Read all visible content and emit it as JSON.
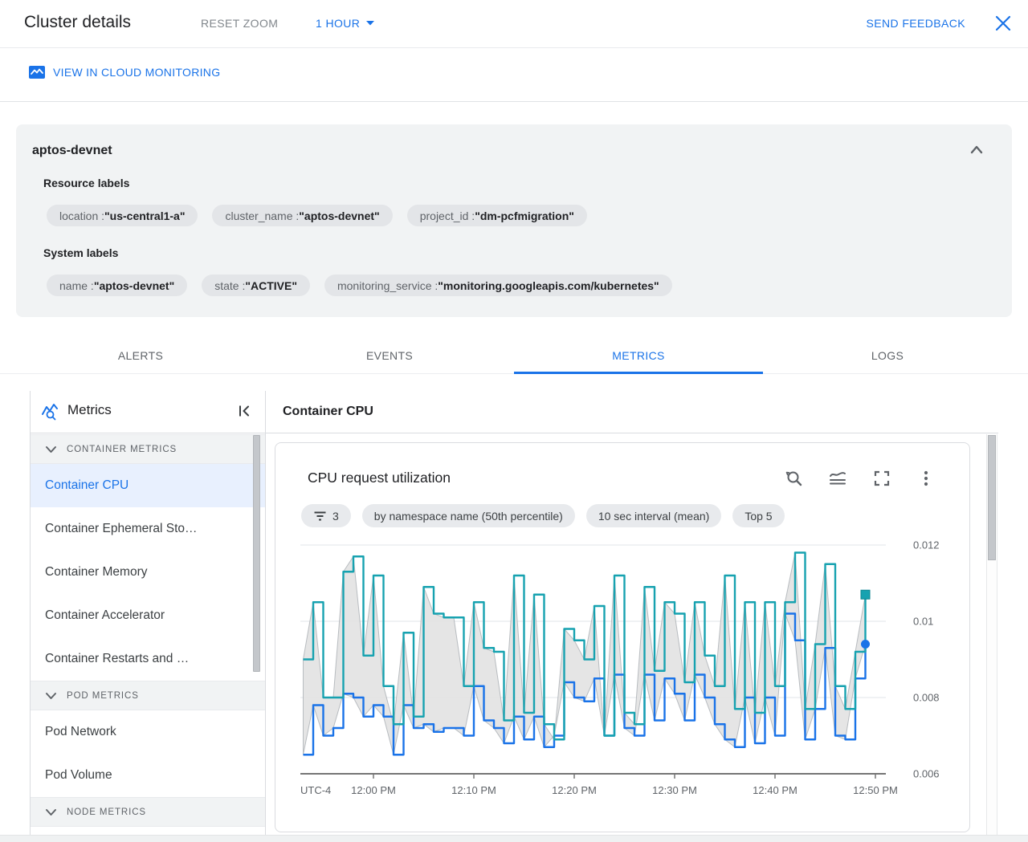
{
  "colors": {
    "accent": "#1a73e8",
    "series_teal": "#17a2b0",
    "series_blue": "#1a73e8",
    "band_fill": "#e4e4e4",
    "band_stroke": "#9aa0a6",
    "selected_bg": "#e8f0fe",
    "card_bg": "#f1f3f4"
  },
  "header": {
    "title": "Cluster details",
    "reset_zoom": "RESET ZOOM",
    "time_range": "1 HOUR",
    "send_feedback": "SEND FEEDBACK"
  },
  "toolbar": {
    "view_in_monitoring": "VIEW IN CLOUD MONITORING"
  },
  "summary": {
    "title": "aptos-devnet",
    "resource_labels_heading": "Resource labels",
    "system_labels_heading": "System labels",
    "separator": " : ",
    "resource_labels": [
      {
        "key": "location",
        "value": "\"us-central1-a\""
      },
      {
        "key": "cluster_name",
        "value": "\"aptos-devnet\""
      },
      {
        "key": "project_id",
        "value": "\"dm-pcfmigration\""
      }
    ],
    "system_labels": [
      {
        "key": "name",
        "value": "\"aptos-devnet\""
      },
      {
        "key": "state",
        "value": "\"ACTIVE\""
      },
      {
        "key": "monitoring_service",
        "value": "\"monitoring.googleapis.com/kubernetes\""
      }
    ]
  },
  "tabs": {
    "items": [
      {
        "label": "ALERTS",
        "active": false
      },
      {
        "label": "EVENTS",
        "active": false
      },
      {
        "label": "METRICS",
        "active": true
      },
      {
        "label": "LOGS",
        "active": false
      }
    ]
  },
  "sidebar": {
    "title": "Metrics",
    "groups": [
      {
        "header": "CONTAINER METRICS",
        "items": [
          {
            "label": "Container CPU",
            "selected": true
          },
          {
            "label": "Container Ephemeral Sto…",
            "selected": false
          },
          {
            "label": "Container Memory",
            "selected": false
          },
          {
            "label": "Container Accelerator",
            "selected": false
          },
          {
            "label": "Container Restarts and …",
            "selected": false
          }
        ]
      },
      {
        "header": "POD METRICS",
        "items": [
          {
            "label": "Pod Network",
            "selected": false
          },
          {
            "label": "Pod Volume",
            "selected": false
          }
        ]
      },
      {
        "header": "NODE METRICS",
        "items": []
      }
    ]
  },
  "main": {
    "section_title": "Container CPU"
  },
  "chart_card": {
    "filters": [
      {
        "icon": "filter-list-icon",
        "label": "3"
      },
      {
        "label": "by namespace name (50th percentile)"
      },
      {
        "label": "10 sec interval (mean)"
      },
      {
        "label": "Top 5"
      }
    ]
  },
  "chart_data": {
    "type": "line",
    "title": "CPU request utilization",
    "grid": true,
    "legend_position": "none",
    "x_axis": {
      "timezone_label": "UTC-4",
      "tick_minutes": [
        0,
        10,
        20,
        30,
        40,
        50
      ],
      "tick_labels": [
        "12:00 PM",
        "12:10 PM",
        "12:20 PM",
        "12:30 PM",
        "12:40 PM",
        "12:50 PM"
      ]
    },
    "y_axis": {
      "ticks": [
        0.006,
        0.008,
        0.01,
        0.012
      ],
      "tick_labels": [
        "0.006",
        "0.008",
        "0.01",
        "0.012"
      ],
      "range": [
        0.006,
        0.0125
      ]
    },
    "x_start_min": -7,
    "x_step_min": 1,
    "band": {
      "between": [
        "upper-teal",
        "lower-blue"
      ]
    },
    "series": [
      {
        "id": "upper-teal",
        "color": "#17a2b0",
        "marker": "square",
        "values": [
          0.009,
          0.0105,
          0.008,
          0.008,
          0.0113,
          0.0117,
          0.0091,
          0.0112,
          0.0083,
          0.0073,
          0.0097,
          0.0075,
          0.0109,
          0.0102,
          0.0101,
          0.0101,
          0.0083,
          0.0105,
          0.0093,
          0.0092,
          0.0074,
          0.0112,
          0.0076,
          0.0107,
          0.0073,
          0.0069,
          0.0098,
          0.0095,
          0.009,
          0.0104,
          0.007,
          0.0112,
          0.0076,
          0.0073,
          0.0109,
          0.0087,
          0.0105,
          0.0102,
          0.0084,
          0.0105,
          0.0091,
          0.0083,
          0.0112,
          0.0077,
          0.0105,
          0.0076,
          0.0105,
          0.0083,
          0.0105,
          0.0118,
          0.0077,
          0.0094,
          0.0115,
          0.0083,
          0.0077,
          0.0092,
          0.0107
        ]
      },
      {
        "id": "lower-blue",
        "color": "#1a73e8",
        "marker": "circle",
        "values": [
          0.0065,
          0.0078,
          0.007,
          0.0072,
          0.0081,
          0.008,
          0.0075,
          0.0078,
          0.0075,
          0.0065,
          0.0078,
          0.0072,
          0.0073,
          0.0071,
          0.0072,
          0.0072,
          0.007,
          0.0083,
          0.0074,
          0.0072,
          0.0068,
          0.0075,
          0.0069,
          0.0075,
          0.0067,
          0.007,
          0.0084,
          0.008,
          0.0079,
          0.0085,
          0.007,
          0.0086,
          0.0072,
          0.007,
          0.0086,
          0.0074,
          0.0085,
          0.0081,
          0.0074,
          0.0086,
          0.008,
          0.0073,
          0.0069,
          0.0067,
          0.008,
          0.0068,
          0.008,
          0.007,
          0.0102,
          0.0095,
          0.0069,
          0.0077,
          0.0093,
          0.007,
          0.0069,
          0.0085,
          0.0094
        ]
      }
    ]
  }
}
